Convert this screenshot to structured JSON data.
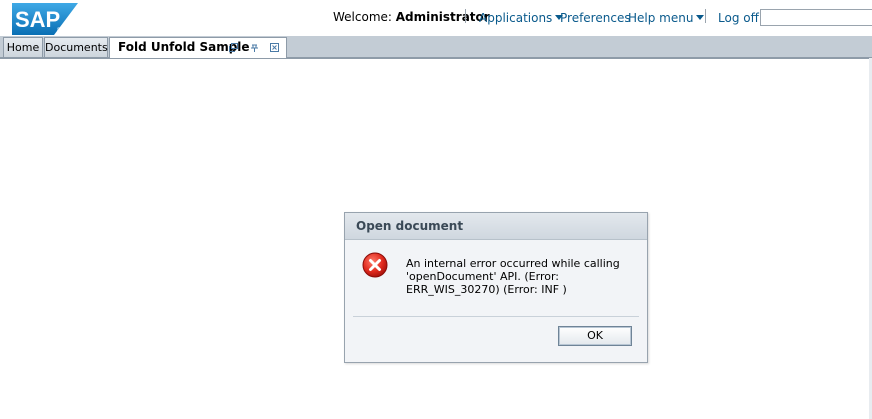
{
  "header": {
    "logo_text": "SAP",
    "welcome_prefix": "Welcome:",
    "user_name": "Administrator",
    "links": {
      "applications": "Applications",
      "preferences": "Preferences",
      "help_menu": "Help menu",
      "log_off": "Log off"
    },
    "search_value": ""
  },
  "tabs": [
    {
      "label": "Home"
    },
    {
      "label": "Documents"
    },
    {
      "label": "Fold Unfold Sample"
    }
  ],
  "dialog": {
    "title": "Open document",
    "icon": "error-icon",
    "message": "An internal error occurred while calling 'openDocument' API. (Error: ERR_WIS_30270) (Error: INF )",
    "ok_label": "OK"
  },
  "colors": {
    "link": "#0a5a8c",
    "tabbar": "#c3ccd5",
    "error_red": "#d62727",
    "dialog_bg": "#f2f4f7"
  }
}
